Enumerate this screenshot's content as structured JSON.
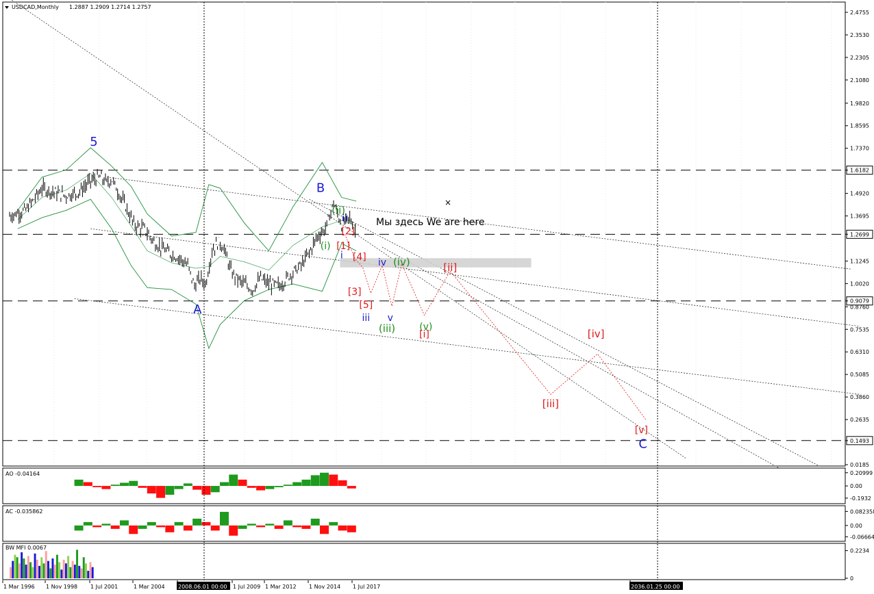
{
  "header": {
    "title": "USDCAD,Monthly",
    "ohlc": "1.2887 1.2909 1.2714 1.2757"
  },
  "annotation_text": "Мы здесь We are here",
  "cross_marker": "×",
  "colors": {
    "blue": "#1a1ad6",
    "green": "#1f8f1f",
    "red": "#e01818",
    "band": "#1f8f3a",
    "price": "#000000",
    "osc_up": "#1e9a1e",
    "osc_down": "#ff1010"
  },
  "chart_data": [
    {
      "type": "line",
      "subtype": "candlestick-ohlc",
      "title": "USDCAD,Monthly",
      "ylim": [
        0.0185,
        2.5
      ],
      "y_ticks": [
        "2.4755",
        "2.3530",
        "2.2305",
        "2.1080",
        "1.9820",
        "1.8595",
        "1.7370",
        "1.6182",
        "1.4920",
        "1.3695",
        "1.2699",
        "1.1245",
        "1.0020",
        "0.9079",
        "0.8760",
        "0.7535",
        "0.6310",
        "0.5085",
        "0.3860",
        "0.2635",
        "0.1493",
        "0.0185"
      ],
      "x_labels": [
        "1 Mar 1996",
        "1 Nov 1998",
        "1 Jul 2001",
        "1 Mar 2004",
        "2008.06.01 00:00",
        "1 Jul 2009",
        "1 Mar 2012",
        "1 Nov 2014",
        "1 Jul 2017",
        "2036.01.25 00:00"
      ],
      "horizontal_levels": [
        "1.6182",
        "1.2699",
        "0.9079",
        "0.1493"
      ],
      "series": [
        {
          "type": "price",
          "x": [
            1996.0,
            1997.0,
            1998.0,
            1998.7,
            1999.5,
            2000.3,
            2001.0,
            2001.6,
            2002.0,
            2002.3,
            2003.0,
            2003.7,
            2004.3,
            2005.0,
            2005.8,
            2006.5,
            2007.0,
            2007.4,
            2007.8,
            2008.1,
            2008.5,
            2008.9,
            2009.2,
            2009.7,
            2010.3,
            2011.0,
            2011.5,
            2012.0,
            2012.7,
            2013.3,
            2014.0,
            2014.5,
            2015.0,
            2015.5,
            2016.0,
            2016.5,
            2017.0,
            2017.4
          ],
          "values": [
            1.37,
            1.4,
            1.52,
            1.5,
            1.48,
            1.5,
            1.56,
            1.58,
            1.55,
            1.57,
            1.45,
            1.32,
            1.3,
            1.22,
            1.17,
            1.14,
            1.1,
            0.99,
            1.03,
            1.0,
            1.18,
            1.23,
            1.2,
            1.06,
            1.01,
            0.97,
            1.03,
            1.0,
            0.99,
            1.05,
            1.1,
            1.17,
            1.26,
            1.3,
            1.44,
            1.32,
            1.36,
            1.2757
          ]
        },
        {
          "type": "bands",
          "upper_x": [
            1996.5,
            1998.0,
            1999.5,
            2001.0,
            2002.3,
            2003.5,
            2004.5,
            2006.0,
            2007.5,
            2008.3,
            2009.0,
            2010.5,
            2012.0,
            2013.5,
            2015.3,
            2016.5,
            2017.4
          ],
          "upper": [
            1.4,
            1.58,
            1.62,
            1.74,
            1.64,
            1.53,
            1.38,
            1.26,
            1.28,
            1.54,
            1.52,
            1.33,
            1.18,
            1.42,
            1.66,
            1.47,
            1.45
          ],
          "lower_x": [
            1996.5,
            1998.0,
            1999.5,
            2001.0,
            2002.3,
            2003.5,
            2004.5,
            2006.0,
            2007.5,
            2008.3,
            2009.0,
            2010.5,
            2012.0,
            2013.5,
            2015.3,
            2016.5,
            2017.4
          ],
          "lower": [
            1.3,
            1.36,
            1.4,
            1.46,
            1.3,
            1.1,
            0.98,
            0.97,
            0.89,
            0.65,
            0.78,
            0.91,
            0.97,
            1.0,
            0.96,
            1.22,
            1.18
          ]
        }
      ],
      "wave_labels": [
        {
          "text": "5",
          "x": 2001.2,
          "y": 1.75,
          "color": "blue"
        },
        {
          "text": "A",
          "x": 2007.6,
          "y": 0.84,
          "color": "blue"
        },
        {
          "text": "B",
          "x": 2015.2,
          "y": 1.5,
          "color": "blue"
        },
        {
          "text": "(i)",
          "x": 2015.5,
          "y": 1.19,
          "color": "green"
        },
        {
          "text": "(ii)",
          "x": 2016.3,
          "y": 1.38,
          "color": "green"
        },
        {
          "text": "ii",
          "x": 2016.7,
          "y": 1.34,
          "color": "blue"
        },
        {
          "text": "[2]",
          "x": 2016.9,
          "y": 1.27,
          "color": "red"
        },
        {
          "text": "[1]",
          "x": 2016.6,
          "y": 1.19,
          "color": "red"
        },
        {
          "text": "i",
          "x": 2016.5,
          "y": 1.14,
          "color": "blue"
        },
        {
          "text": "[4]",
          "x": 2017.6,
          "y": 1.13,
          "color": "red"
        },
        {
          "text": "iv",
          "x": 2019.0,
          "y": 1.1,
          "color": "blue"
        },
        {
          "text": "(iv)",
          "x": 2020.2,
          "y": 1.1,
          "color": "green"
        },
        {
          "text": "[3]",
          "x": 2017.3,
          "y": 0.94,
          "color": "red"
        },
        {
          "text": "[5]",
          "x": 2018.0,
          "y": 0.87,
          "color": "red"
        },
        {
          "text": "iii",
          "x": 2018.0,
          "y": 0.8,
          "color": "blue"
        },
        {
          "text": "v",
          "x": 2019.5,
          "y": 0.8,
          "color": "blue"
        },
        {
          "text": "(iii)",
          "x": 2019.3,
          "y": 0.74,
          "color": "green"
        },
        {
          "text": "(v)",
          "x": 2021.7,
          "y": 0.75,
          "color": "green"
        },
        {
          "text": "[i]",
          "x": 2021.6,
          "y": 0.71,
          "color": "red"
        },
        {
          "text": "[ii]",
          "x": 2023.2,
          "y": 1.07,
          "color": "red"
        },
        {
          "text": "[iv]",
          "x": 2032.2,
          "y": 0.71,
          "color": "red"
        },
        {
          "text": "[iii]",
          "x": 2029.4,
          "y": 0.33,
          "color": "red"
        },
        {
          "text": "[v]",
          "x": 2035.0,
          "y": 0.19,
          "color": "red"
        },
        {
          "text": "C",
          "x": 2035.1,
          "y": 0.11,
          "color": "blue"
        }
      ]
    },
    {
      "type": "bar",
      "title": "AO -0.04164",
      "y_ticks": [
        "0.20999",
        "0.00",
        "-0.1932"
      ],
      "ylim": [
        -0.26,
        0.24
      ],
      "x": [
        2000.0,
        2017.4
      ],
      "values": [
        0.1,
        0.06,
        -0.02,
        -0.05,
        0.02,
        0.05,
        0.08,
        -0.03,
        -0.12,
        -0.19,
        -0.14,
        -0.05,
        0.04,
        -0.06,
        -0.14,
        -0.1,
        0.06,
        0.18,
        0.1,
        -0.03,
        -0.07,
        -0.05,
        -0.02,
        0.02,
        0.06,
        0.1,
        0.17,
        0.21,
        0.18,
        0.09,
        -0.04
      ]
    },
    {
      "type": "bar",
      "title": "AC -0.035862",
      "y_ticks": [
        "0.082358",
        "0.00",
        "-0.06664"
      ],
      "ylim": [
        -0.085,
        0.1
      ],
      "x": [
        2000.0,
        2017.4
      ],
      "values": [
        -0.03,
        0.02,
        -0.01,
        0.01,
        -0.02,
        0.03,
        -0.05,
        -0.02,
        0.02,
        -0.01,
        -0.04,
        0.02,
        -0.03,
        0.04,
        0.02,
        -0.03,
        0.08,
        -0.06,
        -0.02,
        0.01,
        -0.01,
        0.01,
        -0.02,
        0.03,
        -0.01,
        -0.02,
        0.04,
        -0.05,
        0.02,
        -0.03,
        -0.04
      ]
    },
    {
      "type": "bar",
      "title": "BW MFI 0.0067",
      "y_ticks": [
        "0.2234",
        "0"
      ],
      "ylim": [
        0,
        0.26
      ],
      "x": [
        1996.0,
        2001.2
      ],
      "values": [
        0.09,
        0.14,
        0.19,
        0.17,
        0.12,
        0.21,
        0.16,
        0.11,
        0.18,
        0.13,
        0.09,
        0.2,
        0.15,
        0.1,
        0.17,
        0.12,
        0.22,
        0.14,
        0.08,
        0.16,
        0.11,
        0.19,
        0.13,
        0.07,
        0.15,
        0.12,
        0.18,
        0.09,
        0.14,
        0.11,
        0.23,
        0.1,
        0.08,
        0.17,
        0.12,
        0.06,
        0.13,
        0.09
      ]
    }
  ]
}
